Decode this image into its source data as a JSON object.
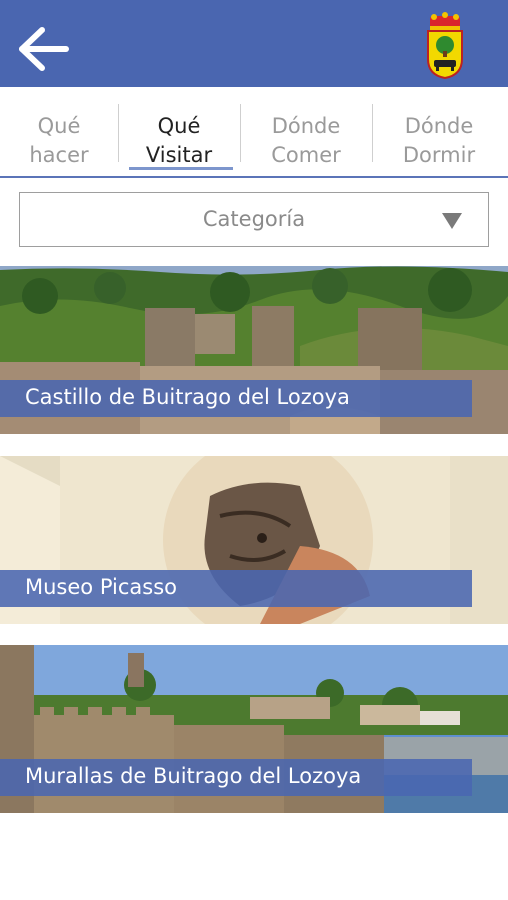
{
  "header": {
    "back_icon": "arrow-left-icon",
    "crest_icon": "municipal-coat-of-arms-icon",
    "background_color": "#4a66b0"
  },
  "tabs": [
    {
      "line1": "Qué",
      "line2": "hacer",
      "active": false
    },
    {
      "line1": "Qué",
      "line2": "Visitar",
      "active": true
    },
    {
      "line1": "Dónde",
      "line2": "Comer",
      "active": false
    },
    {
      "line1": "Dónde",
      "line2": "Dormir",
      "active": false
    }
  ],
  "category_select": {
    "label": "Categoría",
    "icon": "dropdown-triangle-icon"
  },
  "places": [
    {
      "name": "Castillo de Buitrago del Lozoya"
    },
    {
      "name": "Museo Picasso"
    },
    {
      "name": "Murallas de Buitrago del Lozoya"
    }
  ],
  "colors": {
    "accent": "#4a66b0",
    "tab_underline": "#7d96cd",
    "active_text": "#222222",
    "inactive_text": "#9a9a9a"
  }
}
